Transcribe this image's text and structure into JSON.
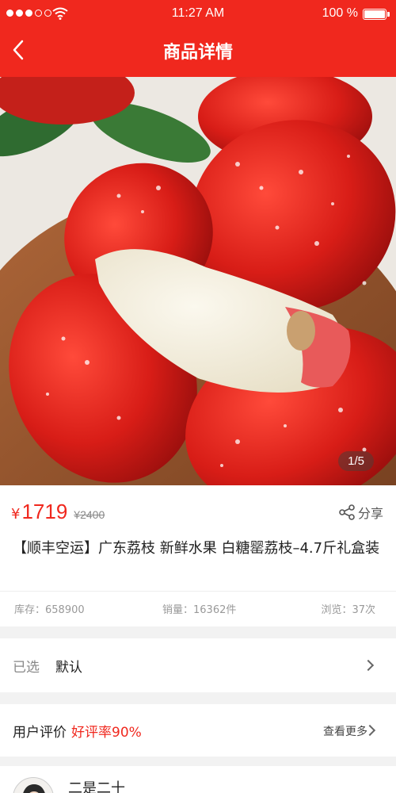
{
  "status_bar": {
    "time": "11:27 AM",
    "battery": "100 %",
    "battery_level": 1.0,
    "signal_bars": 3
  },
  "nav": {
    "title": "商品详情",
    "back_icon": "chevron-left-icon"
  },
  "gallery": {
    "pager": "1/5"
  },
  "product": {
    "currency": "¥",
    "price": "1719",
    "original_price": "¥2400",
    "share_label": "分享",
    "title": "【顺丰空运】广东荔枝 新鲜水果 白糖罂荔枝–4.7斤礼盒装",
    "stock": "库存：658900",
    "sales": "销量：16362件",
    "views": "浏览：37次"
  },
  "selection": {
    "label": "已选",
    "value": "默认"
  },
  "reviews": {
    "label": "用户评价",
    "rate": "好评率90%",
    "more": "查看更多",
    "first_reviewer": "二是二十"
  },
  "colors": {
    "brand": "#f0281e",
    "page_bg": "#f2f2f2"
  }
}
